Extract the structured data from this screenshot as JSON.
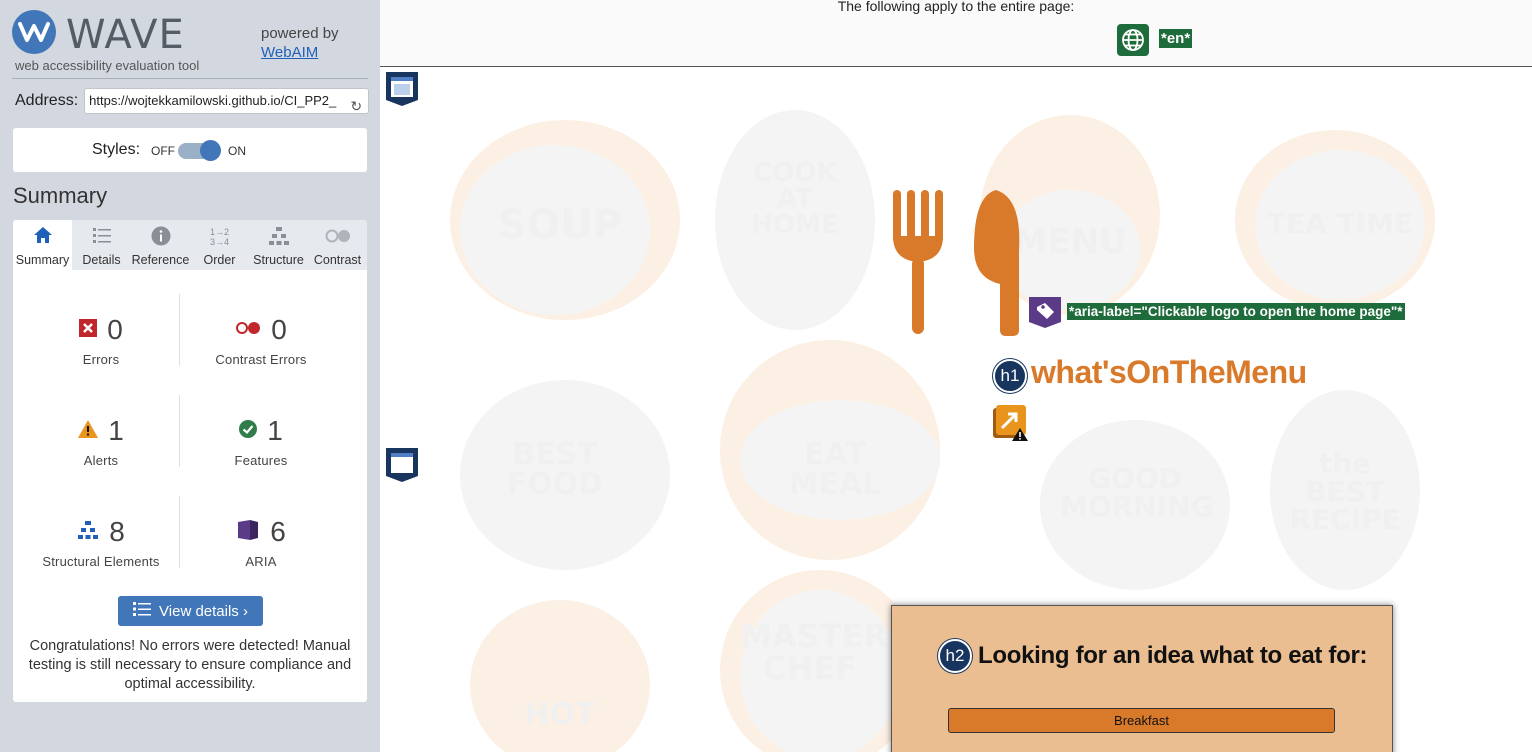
{
  "wave": {
    "logo_word": "WAVE",
    "logo_subtitle": "web accessibility evaluation tool",
    "powered_by": "powered by",
    "powered_link": "WebAIM",
    "address_label": "Address:",
    "address_value": "https://wojtekkamilowski.github.io/CI_PP2_",
    "styles_label": "Styles:",
    "styles_off": "OFF",
    "styles_on": "ON",
    "summary_heading": "Summary",
    "tabs": [
      {
        "label": "Summary",
        "icon": "home-icon"
      },
      {
        "label": "Details",
        "icon": "list-icon"
      },
      {
        "label": "Reference",
        "icon": "info-icon"
      },
      {
        "label": "Order",
        "icon": "order-icon"
      },
      {
        "label": "Structure",
        "icon": "structure-icon"
      },
      {
        "label": "Contrast",
        "icon": "contrast-icon"
      }
    ],
    "stats": {
      "errors": {
        "value": "0",
        "label": "Errors"
      },
      "contrast_errors": {
        "value": "0",
        "label": "Contrast Errors"
      },
      "alerts": {
        "value": "1",
        "label": "Alerts"
      },
      "features": {
        "value": "1",
        "label": "Features"
      },
      "structural": {
        "value": "8",
        "label": "Structural Elements"
      },
      "aria": {
        "value": "6",
        "label": "ARIA"
      }
    },
    "view_details": "View details ›",
    "congrats": "Congratulations! No errors were detected! Manual testing is still necessary to ensure compliance and optimal accessibility."
  },
  "page": {
    "applies_text": "The following apply to the entire page:",
    "lang_tag": "*en*",
    "aria_label": "*aria-label=\"Clickable logo to open the home page\"*",
    "h1_badge": "h1",
    "site_title": "what'sOnTheMenu",
    "h2_badge": "h2",
    "card_title": "Looking for an idea what to eat for:",
    "meal_button": "Breakfast",
    "bg_words": [
      "SOUP",
      "COOK AT HOME",
      "MENU",
      "TEA TIME",
      "BEST FOOD",
      "EAT MEAL",
      "GOOD MORNING",
      "the BEST RECIPE",
      "MASTER CHEF",
      "HOT"
    ]
  },
  "colors": {
    "wave_blue": "#4176b8",
    "aria_green": "#1e6b3c",
    "brand_orange": "#d97a2b",
    "card_bg": "#ebbe91",
    "heading_badge": "#17355f"
  }
}
